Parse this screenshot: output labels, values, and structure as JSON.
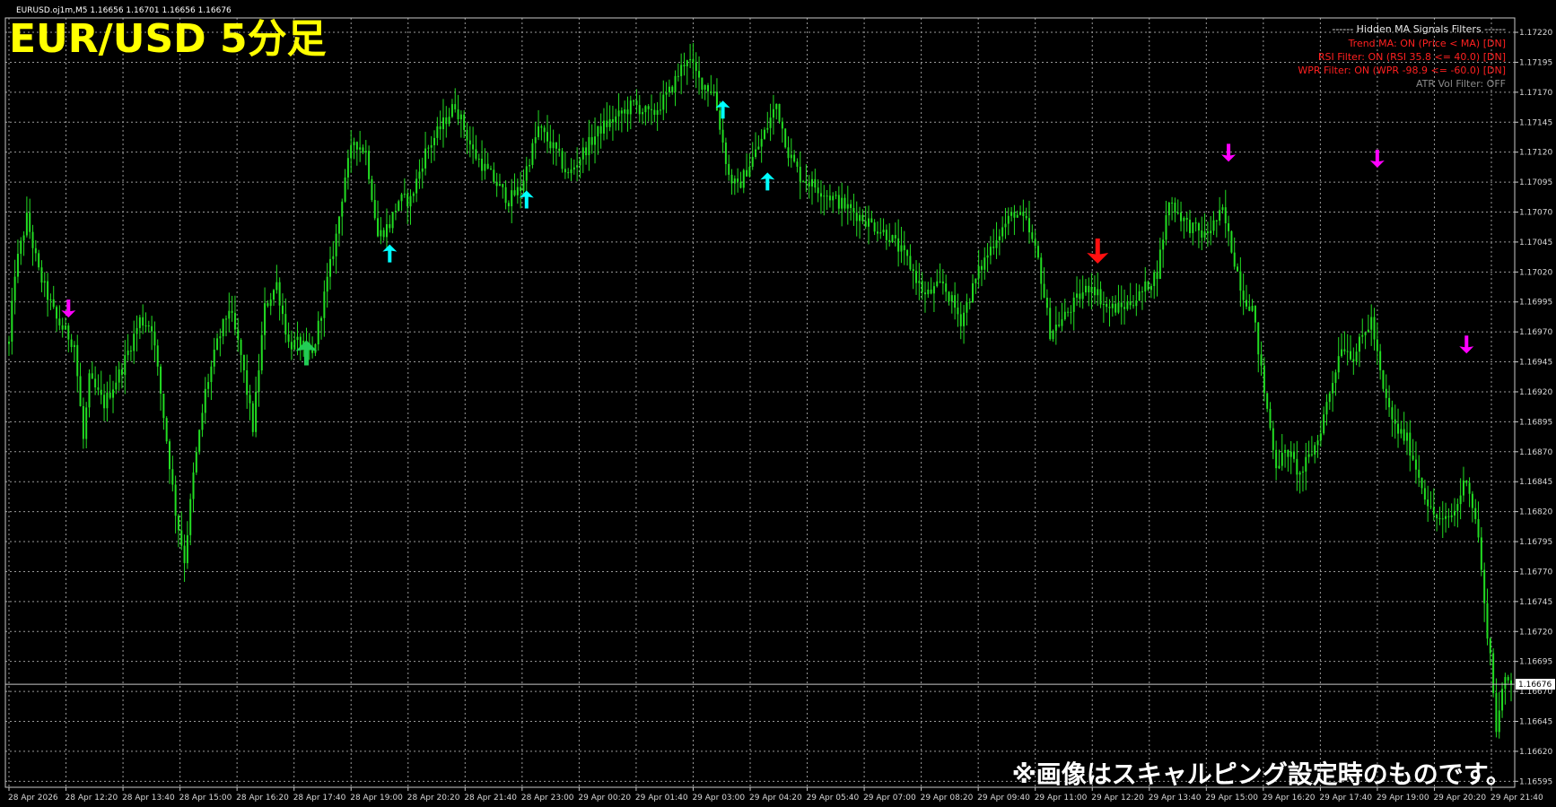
{
  "header": {
    "symbol_info": "EURUSD.oj1m,M5  1.16656 1.16701 1.16656 1.16676",
    "title": "EUR/USD 5分足",
    "note": "※画像はスキャルピング設定時のものです。"
  },
  "filters_panel": {
    "title": "------ Hidden MA Signals Filters ------",
    "lines": [
      {
        "text": "Trend MA: ON (Price < MA) [DN]",
        "color": "#ff2020"
      },
      {
        "text": "RSI Filter: ON (RSI 35.8 <= 40.0) [DN]",
        "color": "#ff2020"
      },
      {
        "text": "WPR Filter: ON (WPR -98.9 <= -60.0) [DN]",
        "color": "#ff2020"
      },
      {
        "text": "ATR Vol Filter: OFF",
        "color": "#8a8a8a"
      }
    ]
  },
  "current_price_label": "1.16676",
  "colors": {
    "background": "#000000",
    "grid": "#9a9a9a",
    "candle": "#22dd22",
    "buy_arrow_minor": "#00ffff",
    "buy_arrow_major": "#22cc55",
    "sell_arrow_minor": "#ff00ff",
    "sell_arrow_major": "#ff1010",
    "title": "#ffff00"
  },
  "chart_data": {
    "type": "candlestick",
    "title": "EUR/USD 5分足",
    "y_ticks": [
      "1.17220",
      "1.17195",
      "1.17170",
      "1.17145",
      "1.17120",
      "1.17095",
      "1.17070",
      "1.17045",
      "1.17020",
      "1.16995",
      "1.16970",
      "1.16945",
      "1.16920",
      "1.16895",
      "1.16870",
      "1.16845",
      "1.16820",
      "1.16795",
      "1.16770",
      "1.16745",
      "1.16720",
      "1.16695",
      "1.16670",
      "1.16645",
      "1.16620",
      "1.16595"
    ],
    "x_ticks": [
      "28 Apr 2026",
      "28 Apr 12:20",
      "28 Apr 13:40",
      "28 Apr 15:00",
      "28 Apr 16:20",
      "28 Apr 17:40",
      "28 Apr 19:00",
      "28 Apr 20:20",
      "28 Apr 21:40",
      "28 Apr 23:00",
      "29 Apr 00:20",
      "29 Apr 01:40",
      "29 Apr 03:00",
      "29 Apr 04:20",
      "29 Apr 05:40",
      "29 Apr 07:00",
      "29 Apr 08:20",
      "29 Apr 09:40",
      "29 Apr 11:00",
      "29 Apr 12:20",
      "29 Apr 13:40",
      "29 Apr 15:00",
      "29 Apr 16:20",
      "29 Apr 17:40",
      "29 Apr 19:00",
      "29 Apr 20:20",
      "29 Apr 21:40"
    ],
    "ylim": [
      1.16595,
      1.1723
    ],
    "grid": true,
    "price_path": [
      [
        0,
        1.1696
      ],
      [
        2,
        1.1702
      ],
      [
        6,
        1.17065
      ],
      [
        10,
        1.1702
      ],
      [
        16,
        1.1698
      ],
      [
        22,
        1.1696
      ],
      [
        25,
        1.1688
      ],
      [
        27,
        1.1693
      ],
      [
        32,
        1.1691
      ],
      [
        38,
        1.1694
      ],
      [
        44,
        1.1698
      ],
      [
        48,
        1.16975
      ],
      [
        52,
        1.169
      ],
      [
        56,
        1.1682
      ],
      [
        59,
        1.1678
      ],
      [
        62,
        1.1685
      ],
      [
        66,
        1.1692
      ],
      [
        70,
        1.1696
      ],
      [
        74,
        1.1699
      ],
      [
        78,
        1.1695
      ],
      [
        82,
        1.1689
      ],
      [
        86,
        1.1699
      ],
      [
        90,
        1.1701
      ],
      [
        94,
        1.1696
      ],
      [
        98,
        1.1696
      ],
      [
        102,
        1.1695
      ],
      [
        106,
        1.17
      ],
      [
        110,
        1.1705
      ],
      [
        113,
        1.171
      ],
      [
        116,
        1.1713
      ],
      [
        120,
        1.1712
      ],
      [
        124,
        1.1705
      ],
      [
        128,
        1.1706
      ],
      [
        131,
        1.1708
      ],
      [
        135,
        1.1708
      ],
      [
        140,
        1.1712
      ],
      [
        145,
        1.1714
      ],
      [
        150,
        1.1716
      ],
      [
        156,
        1.1712
      ],
      [
        162,
        1.171
      ],
      [
        168,
        1.1708
      ],
      [
        172,
        1.1709
      ],
      [
        178,
        1.1714
      ],
      [
        184,
        1.1712
      ],
      [
        188,
        1.171
      ],
      [
        193,
        1.1712
      ],
      [
        199,
        1.1714
      ],
      [
        205,
        1.1715
      ],
      [
        210,
        1.1716
      ],
      [
        216,
        1.1715
      ],
      [
        222,
        1.1717
      ],
      [
        228,
        1.172
      ],
      [
        232,
        1.1718
      ],
      [
        237,
        1.1717
      ],
      [
        242,
        1.171
      ],
      [
        245,
        1.1709
      ],
      [
        249,
        1.1711
      ],
      [
        253,
        1.1713
      ],
      [
        258,
        1.1716
      ],
      [
        262,
        1.1712
      ],
      [
        266,
        1.171
      ],
      [
        272,
        1.1709
      ],
      [
        278,
        1.1708
      ],
      [
        284,
        1.1707
      ],
      [
        290,
        1.1706
      ],
      [
        296,
        1.1705
      ],
      [
        302,
        1.1703
      ],
      [
        308,
        1.17
      ],
      [
        314,
        1.1701
      ],
      [
        320,
        1.1698
      ],
      [
        326,
        1.1702
      ],
      [
        332,
        1.1705
      ],
      [
        338,
        1.1707
      ],
      [
        342,
        1.1706
      ],
      [
        346,
        1.1703
      ],
      [
        350,
        1.1697
      ],
      [
        354,
        1.1698
      ],
      [
        360,
        1.17
      ],
      [
        364,
        1.1701
      ],
      [
        369,
        1.1699
      ],
      [
        374,
        1.1699
      ],
      [
        380,
        1.17
      ],
      [
        386,
        1.1702
      ],
      [
        390,
        1.1708
      ],
      [
        396,
        1.1706
      ],
      [
        402,
        1.1705
      ],
      [
        408,
        1.1707
      ],
      [
        412,
        1.1703
      ],
      [
        415,
        1.17
      ],
      [
        418,
        1.1699
      ],
      [
        422,
        1.1692
      ],
      [
        426,
        1.1686
      ],
      [
        430,
        1.1687
      ],
      [
        434,
        1.1685
      ],
      [
        440,
        1.1688
      ],
      [
        444,
        1.1692
      ],
      [
        448,
        1.1696
      ],
      [
        452,
        1.1695
      ],
      [
        458,
        1.1698
      ],
      [
        462,
        1.1692
      ],
      [
        466,
        1.1689
      ],
      [
        470,
        1.1688
      ],
      [
        474,
        1.1685
      ],
      [
        478,
        1.1682
      ],
      [
        482,
        1.1681
      ],
      [
        486,
        1.1682
      ],
      [
        490,
        1.1685
      ],
      [
        494,
        1.168
      ],
      [
        496,
        1.1674
      ],
      [
        498,
        1.167
      ],
      [
        500,
        1.1664
      ],
      [
        503,
        1.1668
      ]
    ]
  },
  "signals": [
    {
      "type": "sell",
      "size": "minor",
      "t": 20,
      "price": 1.16985
    },
    {
      "type": "buy",
      "size": "major",
      "t": 100,
      "price": 1.1696
    },
    {
      "type": "buy",
      "size": "minor",
      "t": 128,
      "price": 1.1704
    },
    {
      "type": "buy",
      "size": "minor",
      "t": 174,
      "price": 1.17085
    },
    {
      "type": "buy",
      "size": "minor",
      "t": 240,
      "price": 1.1716
    },
    {
      "type": "buy",
      "size": "minor",
      "t": 255,
      "price": 1.171
    },
    {
      "type": "sell",
      "size": "major",
      "t": 366,
      "price": 1.1703
    },
    {
      "type": "sell",
      "size": "minor",
      "t": 410,
      "price": 1.17115
    },
    {
      "type": "sell",
      "size": "minor",
      "t": 460,
      "price": 1.1711
    },
    {
      "type": "sell",
      "size": "minor",
      "t": 490,
      "price": 1.16955
    }
  ]
}
